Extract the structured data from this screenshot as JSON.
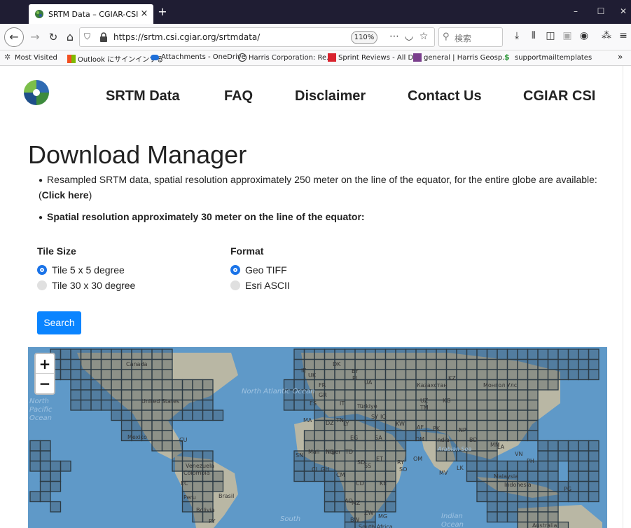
{
  "browser": {
    "tab_title": "SRTM Data – CGIAR-CSI SRTM",
    "tab_close": "×",
    "new_tab": "+",
    "url": "https://srtm.csi.cgiar.org/srtmdata/",
    "zoom": "110%",
    "search_placeholder": "検索",
    "min": "–",
    "max": "☐",
    "close": "✕"
  },
  "bookmarks": [
    "Most Visited",
    "Outlook にサインインする",
    "Attachments - OneDrive",
    "Harris Corporation: Re...",
    "Sprint Reviews - All D...",
    "general | Harris Geosp...",
    "supportmailtemplates"
  ],
  "bookmarks_overflow": "»",
  "site_nav": [
    "SRTM Data",
    "FAQ",
    "Disclaimer",
    "Contact Us",
    "CGIAR CSI"
  ],
  "page": {
    "title": "Download Manager",
    "intro": "Resampled SRTM data, spatial resolution approximately 250 meter on the line of the equator, for the entire globe are available: (",
    "intro_link": "Click here",
    "intro_end": ")",
    "resolution_note": "Spatial resolution approximately 30 meter on the line of the equator:",
    "tile_size_label": "Tile Size",
    "tile_options": [
      "Tile 5 x 5 degree",
      "Tile 30 x 30 degree"
    ],
    "tile_selected": "Tile 5 x 5 degree",
    "format_label": "Format",
    "format_options": [
      "Geo TIFF",
      "Esri ASCII"
    ],
    "format_selected": "Geo TIFF",
    "search_button": "Search"
  },
  "map": {
    "zoom_in": "+",
    "zoom_out": "−",
    "ocean_labels": [
      "North Atlantic Ocean",
      "North Pacific Ocean",
      "South",
      "Indian Ocean",
      "Arabian Sea"
    ],
    "country_labels": [
      "Canada",
      "United States",
      "Mexico",
      "CU",
      "Venezuela",
      "Colombia",
      "EC",
      "Peru",
      "Brasil",
      "Bolivia",
      "PY",
      "DK",
      "BY",
      "UA",
      "PL",
      "IE",
      "UK",
      "FR",
      "ES",
      "IT",
      "Казахстан",
      "Монгол Улс",
      "UZ",
      "KG",
      "TM",
      "Türkiye",
      "MA",
      "Mali",
      "Niger",
      "TD",
      "ET",
      "SS",
      "SO",
      "KE",
      "CD",
      "AO",
      "NG",
      "CI",
      "GH",
      "CM",
      "India",
      "NP",
      "BD",
      "MM",
      "LA",
      "VN",
      "PH",
      "Malaysia",
      "Indonesia",
      "PG",
      "Australia",
      "AF",
      "PK",
      "IQ",
      "SA",
      "KW",
      "DM",
      "OM",
      "RY",
      "MZ",
      "ZW",
      "BW",
      "MG",
      "LK",
      "MV",
      "South Africa",
      "SN",
      "GR",
      "DZ",
      "TN",
      "SY",
      "EG",
      "LY",
      "SD",
      "KZ"
    ],
    "colors": {
      "ocean": "#5f99c8",
      "land": "#b9b7a4",
      "tile": "#5b6b75"
    }
  },
  "colors": {
    "accent": "#0a84ff",
    "radio_on": "#1a73e8",
    "titlebar": "#1f1d33"
  }
}
